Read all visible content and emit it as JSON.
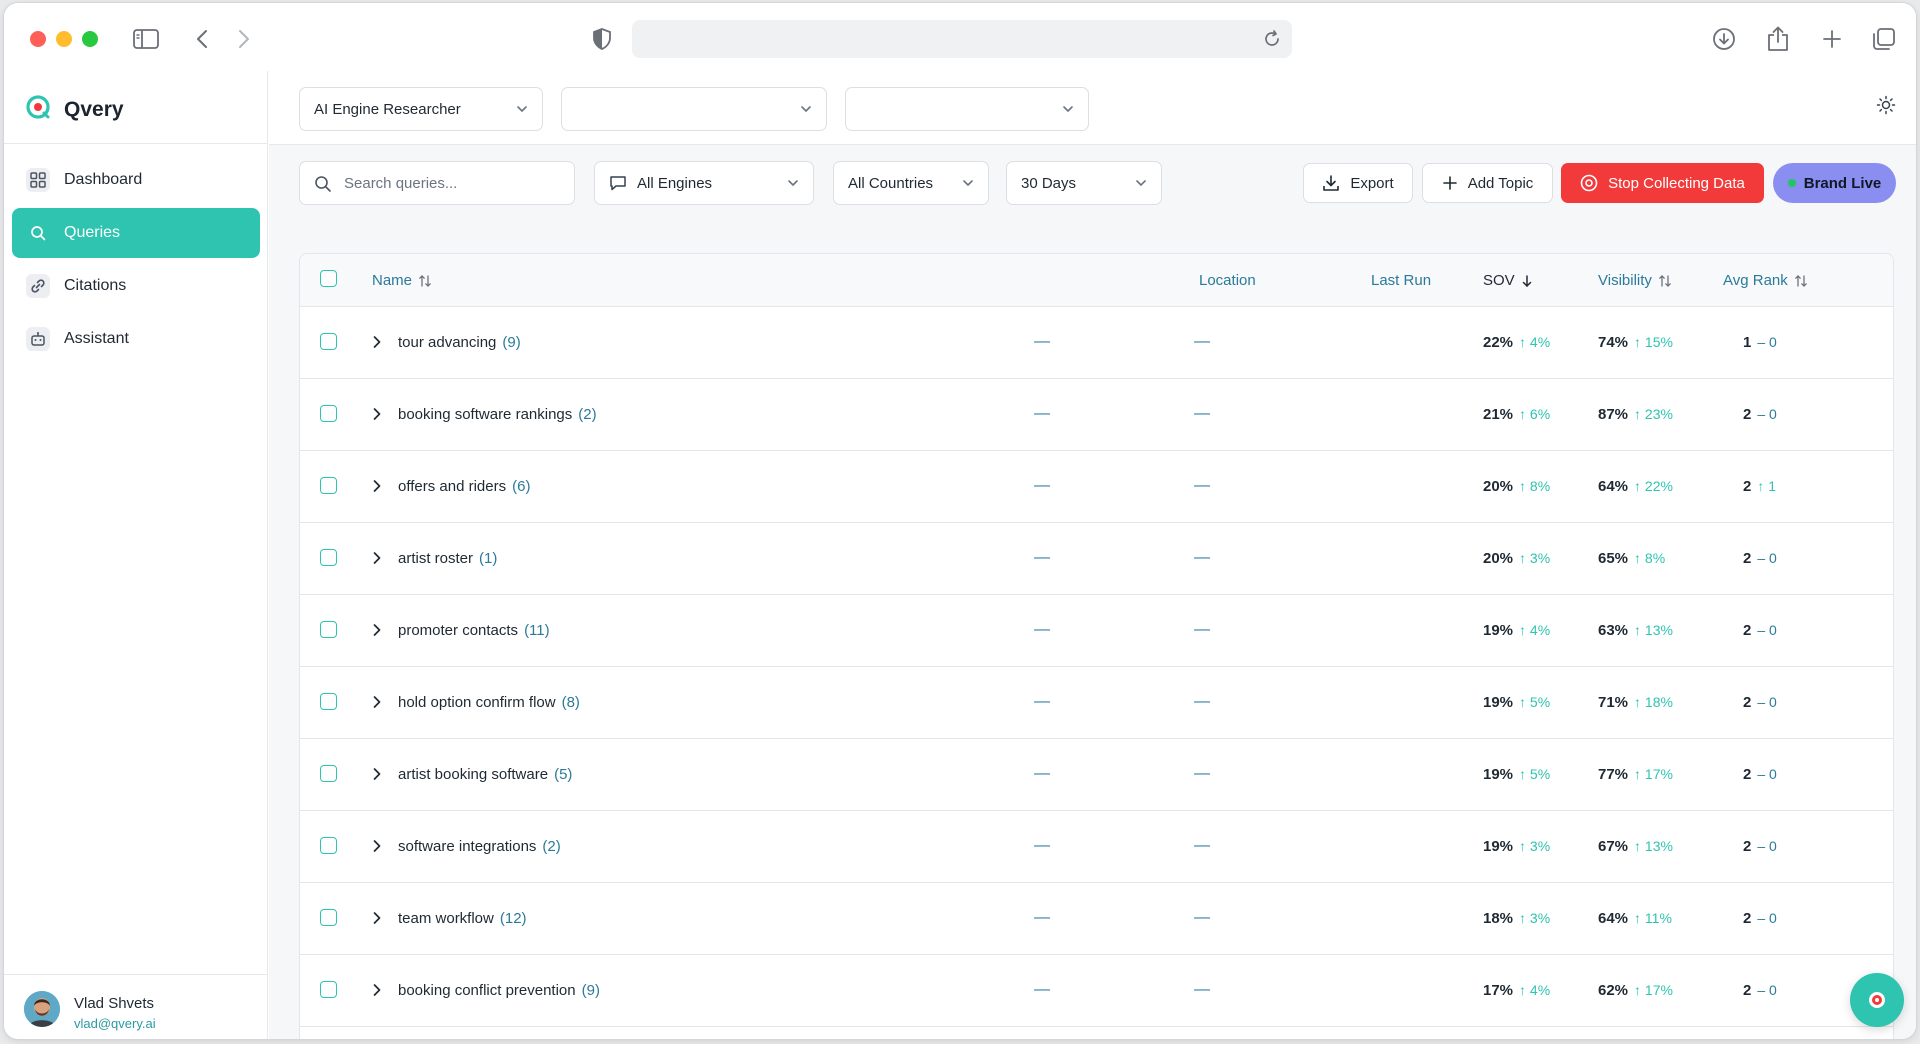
{
  "app": {
    "brand_name": "Qvery"
  },
  "sidebar": {
    "items": [
      {
        "label": "Dashboard",
        "icon": "grid-icon"
      },
      {
        "label": "Queries",
        "icon": "search-icon"
      },
      {
        "label": "Citations",
        "icon": "link-icon"
      },
      {
        "label": "Assistant",
        "icon": "robot-icon"
      }
    ],
    "active_index": 1,
    "user": {
      "name": "Vlad Shvets",
      "email": "vlad@qvery.ai"
    }
  },
  "topbar": {
    "selectors": [
      {
        "value": "AI Engine Researcher"
      },
      {
        "value": ""
      },
      {
        "value": ""
      }
    ]
  },
  "filters": {
    "search_placeholder": "Search queries...",
    "engine": "All Engines",
    "country": "All Countries",
    "range": "30 Days",
    "export_label": "Export",
    "add_topic_label": "Add Topic",
    "stop_label": "Stop Collecting Data",
    "live_label": "Brand Live"
  },
  "table": {
    "headers": {
      "name": "Name",
      "location": "Location",
      "last_run": "Last Run",
      "sov": "SOV",
      "visibility": "Visibility",
      "avg_rank": "Avg Rank"
    },
    "rows": [
      {
        "name": "tour advancing",
        "count": "(9)",
        "location": "—",
        "last_run": "—",
        "sov": "22%",
        "sov_delta": "↑ 4%",
        "vis": "74%",
        "vis_delta": "↑ 15%",
        "rank": "1",
        "rank_delta": "– 0"
      },
      {
        "name": "booking software rankings",
        "count": "(2)",
        "location": "—",
        "last_run": "—",
        "sov": "21%",
        "sov_delta": "↑ 6%",
        "vis": "87%",
        "vis_delta": "↑ 23%",
        "rank": "2",
        "rank_delta": "– 0"
      },
      {
        "name": "offers and riders",
        "count": "(6)",
        "location": "—",
        "last_run": "—",
        "sov": "20%",
        "sov_delta": "↑ 8%",
        "vis": "64%",
        "vis_delta": "↑ 22%",
        "rank": "2",
        "rank_delta": "↑ 1"
      },
      {
        "name": "artist roster",
        "count": "(1)",
        "location": "—",
        "last_run": "—",
        "sov": "20%",
        "sov_delta": "↑ 3%",
        "vis": "65%",
        "vis_delta": "↑ 8%",
        "rank": "2",
        "rank_delta": "– 0"
      },
      {
        "name": "promoter contacts",
        "count": "(11)",
        "location": "—",
        "last_run": "—",
        "sov": "19%",
        "sov_delta": "↑ 4%",
        "vis": "63%",
        "vis_delta": "↑ 13%",
        "rank": "2",
        "rank_delta": "– 0"
      },
      {
        "name": "hold option confirm flow",
        "count": "(8)",
        "location": "—",
        "last_run": "—",
        "sov": "19%",
        "sov_delta": "↑ 5%",
        "vis": "71%",
        "vis_delta": "↑ 18%",
        "rank": "2",
        "rank_delta": "– 0"
      },
      {
        "name": "artist booking software",
        "count": "(5)",
        "location": "—",
        "last_run": "—",
        "sov": "19%",
        "sov_delta": "↑ 5%",
        "vis": "77%",
        "vis_delta": "↑ 17%",
        "rank": "2",
        "rank_delta": "– 0"
      },
      {
        "name": "software integrations",
        "count": "(2)",
        "location": "—",
        "last_run": "—",
        "sov": "19%",
        "sov_delta": "↑ 3%",
        "vis": "67%",
        "vis_delta": "↑ 13%",
        "rank": "2",
        "rank_delta": "– 0"
      },
      {
        "name": "team workflow",
        "count": "(12)",
        "location": "—",
        "last_run": "—",
        "sov": "18%",
        "sov_delta": "↑ 3%",
        "vis": "64%",
        "vis_delta": "↑ 11%",
        "rank": "2",
        "rank_delta": "– 0"
      },
      {
        "name": "booking conflict prevention",
        "count": "(9)",
        "location": "—",
        "last_run": "—",
        "sov": "17%",
        "sov_delta": "↑ 4%",
        "vis": "62%",
        "vis_delta": "↑ 17%",
        "rank": "2",
        "rank_delta": "– 0"
      }
    ]
  },
  "colors": {
    "accent": "#2ec4b0",
    "danger": "#f33a3a",
    "live": "#8a8ef0",
    "link": "#2b7a9a"
  }
}
